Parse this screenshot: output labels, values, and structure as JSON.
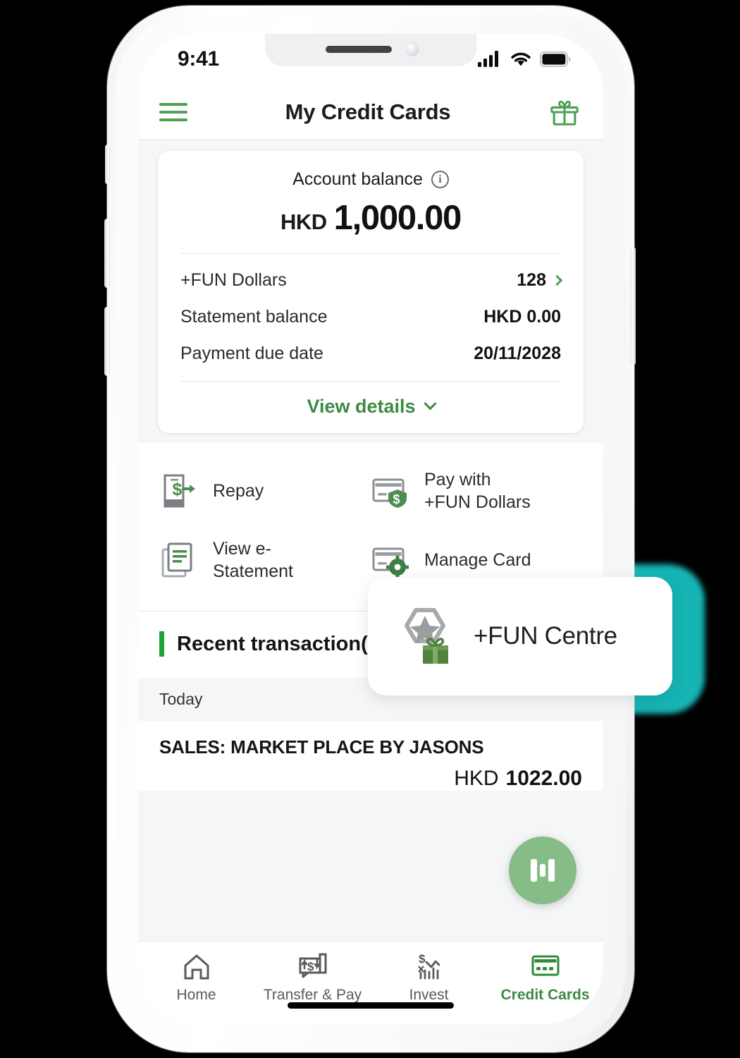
{
  "theme": {
    "brand_green": "#3d8b43",
    "accent_green": "#4e9f52",
    "highlight_teal": "#17b4b4",
    "fab_green": "#86bd86",
    "bar_green": "#21a238"
  },
  "status_bar": {
    "time": "9:41",
    "icons": [
      "cellular-signal-icon",
      "wifi-icon",
      "battery-icon"
    ]
  },
  "header": {
    "menu_icon": "hamburger-menu-icon",
    "title": "My Credit Cards",
    "rewards_icon": "gift-icon"
  },
  "balance_card": {
    "label": "Account balance",
    "info_icon": "info-icon",
    "currency": "HKD",
    "amount": "1,000.00",
    "rows": [
      {
        "key": "+FUN Dollars",
        "value": "128",
        "has_chevron": true
      },
      {
        "key": "Statement balance",
        "value": "HKD 0.00",
        "has_chevron": false
      },
      {
        "key": "Payment due date",
        "value": "20/11/2028",
        "has_chevron": false
      }
    ],
    "view_details": "View details",
    "view_details_icon": "chevron-down-icon"
  },
  "shortcuts": [
    {
      "label": "Repay",
      "icon": "repay-dollar-icon"
    },
    {
      "label": "Pay with\n+FUN Dollars",
      "icon": "card-dollar-shield-icon"
    },
    {
      "label": "View e-\nStatement",
      "icon": "documents-icon"
    },
    {
      "label": "Manage Card",
      "icon": "card-gear-icon"
    }
  ],
  "callout": {
    "label": "+FUN Centre",
    "icon": "star-hexagon-gift-icon"
  },
  "recent_transactions": {
    "title": "Recent transaction(s)",
    "day_label": "Today",
    "items": [
      {
        "name": "SALES: MARKET PLACE BY JASONS",
        "currency": "HKD",
        "amount": "1022.00"
      }
    ]
  },
  "fab": {
    "icon": "assistant-icon"
  },
  "tabbar": {
    "items": [
      {
        "label": "Home",
        "icon": "home-icon",
        "active": false
      },
      {
        "label": "Transfer & Pay",
        "icon": "transfer-pay-icon",
        "active": false
      },
      {
        "label": "Invest",
        "icon": "invest-chart-icon",
        "active": false
      },
      {
        "label": "Credit Cards",
        "icon": "credit-card-icon",
        "active": true
      }
    ]
  }
}
